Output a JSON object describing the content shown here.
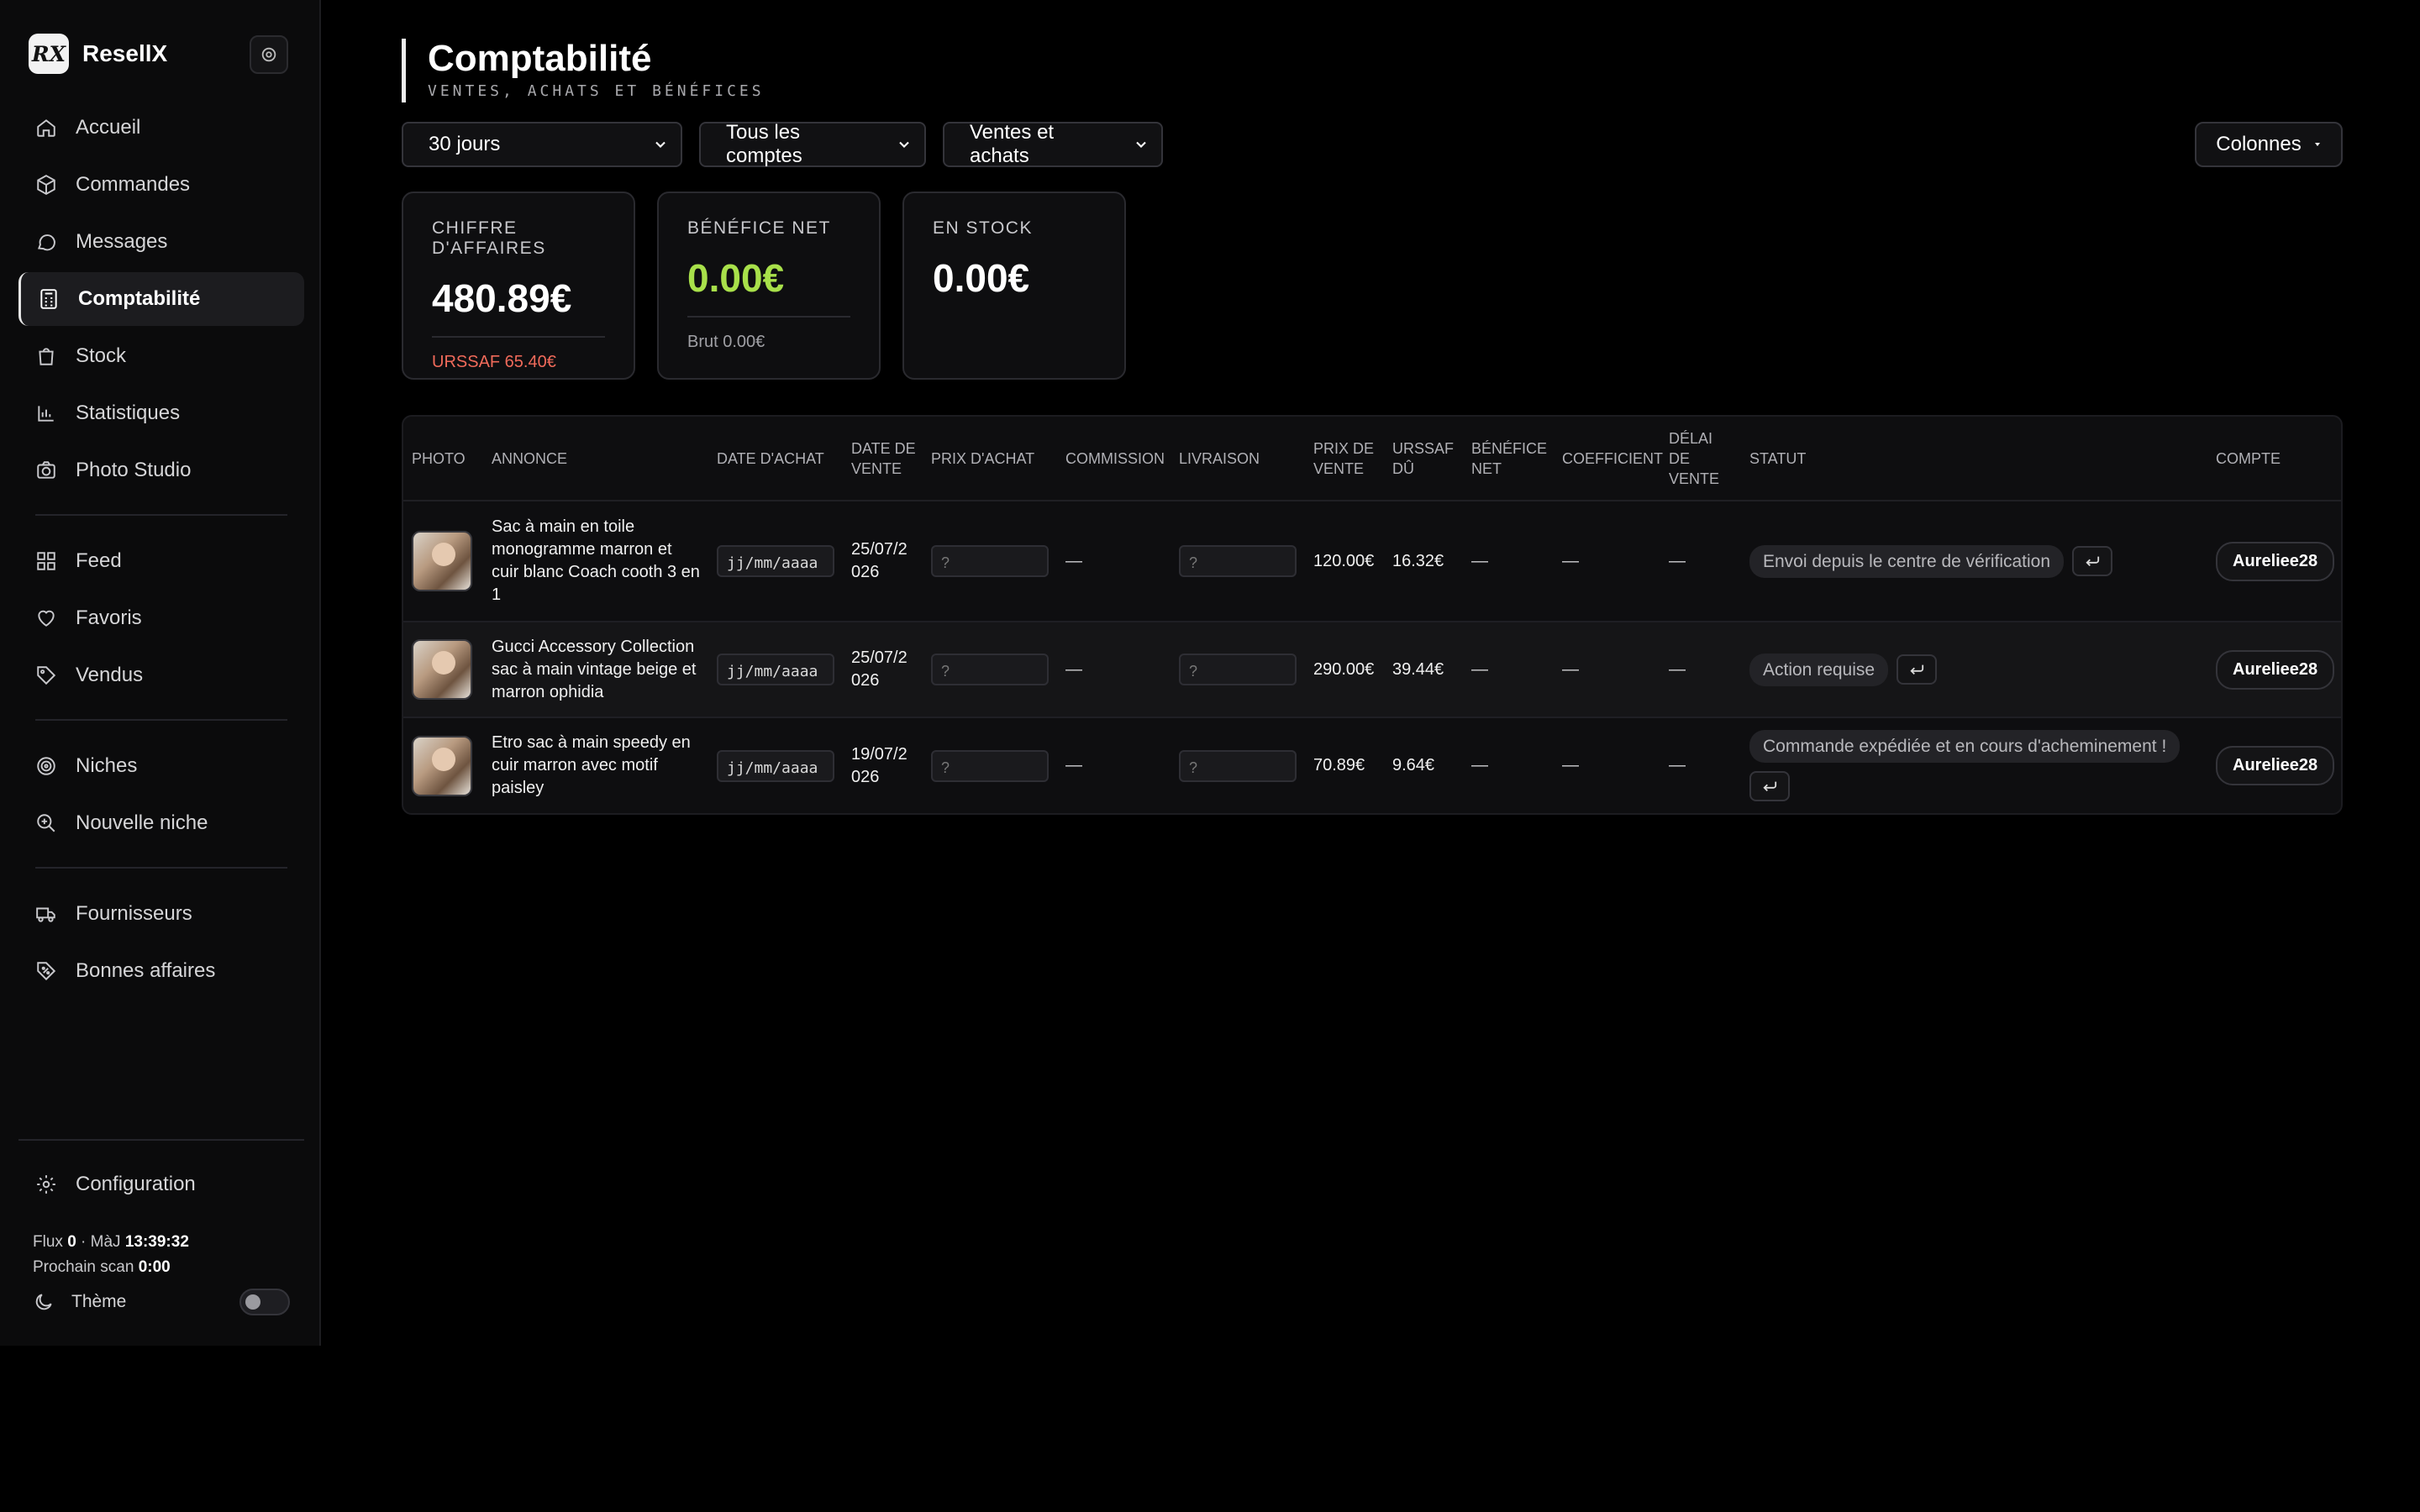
{
  "app": {
    "name": "ResellX",
    "logo_text": "RX"
  },
  "sidebar": {
    "group1": [
      {
        "label": "Accueil",
        "icon": "home-icon"
      },
      {
        "label": "Commandes",
        "icon": "box-icon"
      },
      {
        "label": "Messages",
        "icon": "message-icon"
      },
      {
        "label": "Comptabilité",
        "icon": "calculator-icon",
        "active": true
      },
      {
        "label": "Stock",
        "icon": "bag-icon"
      },
      {
        "label": "Statistiques",
        "icon": "bar-chart-icon"
      },
      {
        "label": "Photo Studio",
        "icon": "camera-icon"
      }
    ],
    "group2": [
      {
        "label": "Feed",
        "icon": "grid-icon"
      },
      {
        "label": "Favoris",
        "icon": "heart-icon"
      },
      {
        "label": "Vendus",
        "icon": "tag-icon"
      }
    ],
    "group3": [
      {
        "label": "Niches",
        "icon": "target-icon"
      },
      {
        "label": "Nouvelle niche",
        "icon": "search-plus-icon"
      }
    ],
    "group4": [
      {
        "label": "Fournisseurs",
        "icon": "truck-icon"
      },
      {
        "label": "Bonnes affaires",
        "icon": "discount-tag-icon"
      }
    ],
    "config_label": "Configuration",
    "status": {
      "flux_label": "Flux",
      "flux_value": "0",
      "maj_label": "· MàJ",
      "maj_value": "13:39:32",
      "scan_label": "Prochain scan",
      "scan_value": "0:00"
    },
    "theme_label": "Thème"
  },
  "page": {
    "title": "Comptabilité",
    "subtitle": "VENTES, ACHATS ET BÉNÉFICES"
  },
  "filters": {
    "period": "30 jours",
    "accounts": "Tous les comptes",
    "type": "Ventes et achats",
    "columns_label": "Colonnes"
  },
  "kpis": {
    "revenue": {
      "label": "CHIFFRE D'AFFAIRES",
      "value": "480.89€",
      "foot": "URSSAF 65.40€"
    },
    "profit": {
      "label": "BÉNÉFICE NET",
      "value": "0.00€",
      "foot": "Brut 0.00€"
    },
    "stock": {
      "label": "EN STOCK",
      "value": "0.00€"
    }
  },
  "colors": {
    "accent_green": "#a8e04a",
    "urssaf_red": "#f06a5a",
    "background": "#000000"
  },
  "table": {
    "headers": {
      "photo": "PHOTO",
      "annonce": "ANNONCE",
      "date_achat": "DATE D'ACHAT",
      "date_vente": "DATE DE VENTE",
      "prix_achat": "PRIX D'ACHAT",
      "commission": "COMMISSION",
      "livraison": "LIVRAISON",
      "prix_vente": "PRIX DE VENTE",
      "urssaf": "URSSAF DÛ",
      "benefice": "BÉNÉFICE NET",
      "coefficient": "COEFFICIENT",
      "delai": "DÉLAI DE VENTE",
      "statut": "STATUT",
      "compte": "COMPTE"
    },
    "date_placeholder": "jj/mm/aaaa",
    "price_placeholder": "?",
    "empty": "—",
    "rows": [
      {
        "annonce": "Sac à main en toile monogramme marron et cuir blanc Coach cooth 3 en 1",
        "date_vente": "25/07/2026",
        "prix_vente": "120.00€",
        "urssaf": "16.32€",
        "statut": "Envoi depuis le centre de vérification",
        "compte": "Aureliee28"
      },
      {
        "annonce": "Gucci Accessory Collection sac à main vintage beige et marron ophidia",
        "date_vente": "25/07/2026",
        "prix_vente": "290.00€",
        "urssaf": "39.44€",
        "statut": "Action requise",
        "compte": "Aureliee28"
      },
      {
        "annonce": "Etro sac à main speedy en cuir marron avec motif paisley",
        "date_vente": "19/07/2026",
        "prix_vente": "70.89€",
        "urssaf": "9.64€",
        "statut": "Commande expédiée et en cours d'acheminement !",
        "compte": "Aureliee28"
      }
    ]
  }
}
